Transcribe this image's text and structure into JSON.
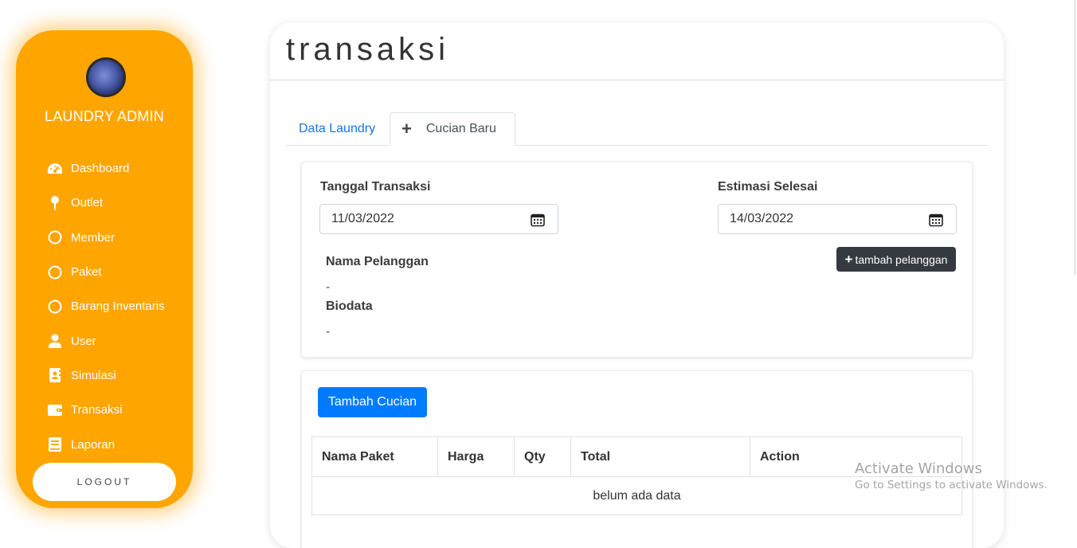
{
  "sidebar": {
    "brand": "LAUNDRY ADMIN",
    "items": [
      {
        "label": "Dashboard",
        "icon": "dashboard-icon"
      },
      {
        "label": "Outlet",
        "icon": "map-pin-icon"
      },
      {
        "label": "Member",
        "icon": "circle-icon"
      },
      {
        "label": "Paket",
        "icon": "circle-icon"
      },
      {
        "label": "Barang Inventaris",
        "icon": "circle-icon"
      },
      {
        "label": "User",
        "icon": "user-icon"
      },
      {
        "label": "Simulasi",
        "icon": "contact-book-icon"
      },
      {
        "label": "Transaksi",
        "icon": "wallet-icon"
      },
      {
        "label": "Laporan",
        "icon": "book-icon"
      }
    ],
    "logout": "LOGOUT"
  },
  "main": {
    "title": "transaksi",
    "tabs": [
      {
        "label": "Data Laundry",
        "active": false
      },
      {
        "label": "Cucian Baru",
        "active": true,
        "prefix": "+"
      }
    ],
    "form": {
      "tanggal_label": "Tanggal Transaksi",
      "tanggal_value": "11/03/2022",
      "estimasi_label": "Estimasi Selesai",
      "estimasi_value": "14/03/2022",
      "tambah_pelanggan": "tambah pelanggan",
      "tambah_pelanggan_prefix": "+",
      "nama_label": "Nama Pelanggan",
      "nama_value": "-",
      "biodata_label": "Biodata",
      "biodata_value": "-"
    },
    "cucian": {
      "tambah_button": "Tambah Cucian",
      "columns": [
        "Nama Paket",
        "Harga",
        "Qty",
        "Total",
        "Action"
      ],
      "empty_text": "belum ada data"
    }
  },
  "watermark": {
    "title": "Activate Windows",
    "subtitle": "Go to Settings to activate Windows."
  },
  "colors": {
    "sidebar_bg": "#ffa500",
    "primary": "#007bff",
    "dark_button": "#343a40",
    "tab_link": "#1a73e8"
  }
}
